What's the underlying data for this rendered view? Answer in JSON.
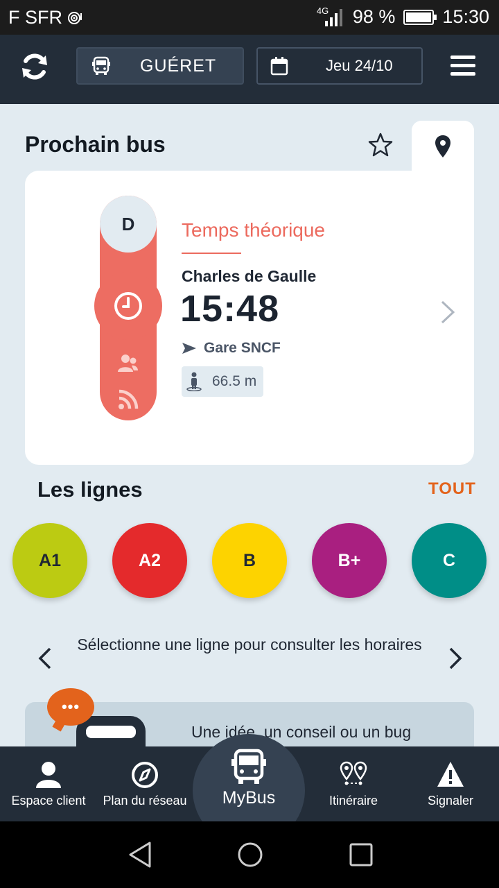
{
  "status_bar": {
    "carrier": "F SFR",
    "network": "4G",
    "battery": "98 %",
    "battery_fill": 0.98,
    "time": "15:30"
  },
  "header": {
    "city": "GUÉRET",
    "date": "Jeu 24/10"
  },
  "next_bus": {
    "title": "Prochain bus",
    "line_letter": "D",
    "time_type": "Temps théorique",
    "stop": "Charles de Gaulle",
    "time": "15:48",
    "direction": "Gare SNCF",
    "distance": "66.5 m"
  },
  "lines": {
    "title": "Les lignes",
    "all_label": "TOUT",
    "items": [
      {
        "label": "A1",
        "color": "#bccb12",
        "text_color": "#1f2733"
      },
      {
        "label": "A2",
        "color": "#e42a2c",
        "text_color": "#ffffff"
      },
      {
        "label": "B",
        "color": "#fdd300",
        "text_color": "#1f2733"
      },
      {
        "label": "B+",
        "color": "#a91f80",
        "text_color": "#ffffff"
      },
      {
        "label": "C",
        "color": "#008e87",
        "text_color": "#ffffff"
      }
    ]
  },
  "selector": {
    "text": "Sélectionne une ligne pour consulter les horaires"
  },
  "banner": {
    "bubble": "•••",
    "text": "Une idée, un conseil ou un bug"
  },
  "bottom_nav": {
    "espace_client": "Espace client",
    "plan": "Plan du réseau",
    "mybus": "MyBus",
    "itineraire": "Itinéraire",
    "signaler": "Signaler"
  },
  "colors": {
    "header_bg": "#232d39",
    "accent": "#ed6d62",
    "orange": "#e3631c",
    "page_bg": "#e2ebf1"
  }
}
